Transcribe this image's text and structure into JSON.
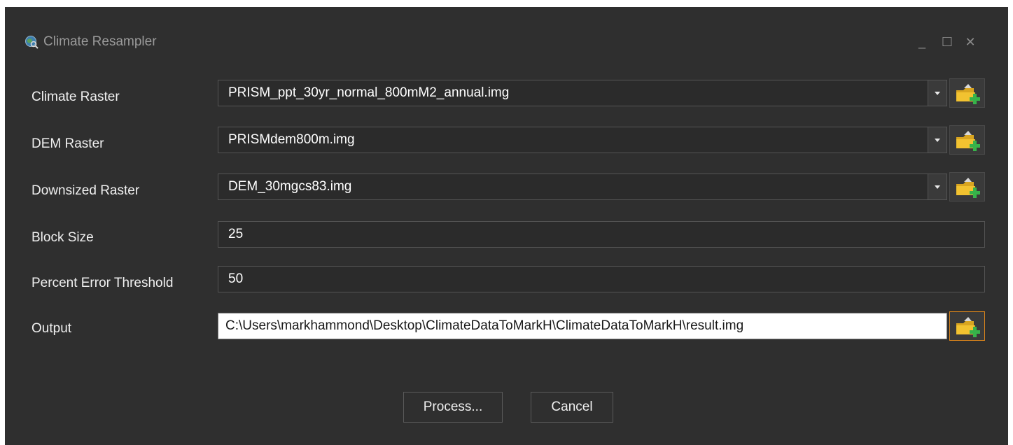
{
  "window": {
    "title": "Climate Resampler",
    "controls": {
      "minimize": "_",
      "maximize": "☐",
      "close": "✕"
    }
  },
  "form": {
    "climate_raster": {
      "label": "Climate Raster",
      "value": "PRISM_ppt_30yr_normal_800mM2_annual.img"
    },
    "dem_raster": {
      "label": "DEM Raster",
      "value": "PRISMdem800m.img"
    },
    "downsized_raster": {
      "label": "Downsized Raster",
      "value": "DEM_30mgcs83.img"
    },
    "block_size": {
      "label": "Block Size",
      "value": "25"
    },
    "percent_error": {
      "label": "Percent Error Threshold",
      "value": "50"
    },
    "output": {
      "label": "Output",
      "value": "C:\\Users\\markhammond\\Desktop\\ClimateDataToMarkH\\ClimateDataToMarkH\\result.img"
    }
  },
  "buttons": {
    "process": "Process...",
    "cancel": "Cancel"
  },
  "icons": {
    "app": "globe-magnifier-icon",
    "browse": "add-folder-icon",
    "dropdown": "dropdown-arrow-icon"
  },
  "colors": {
    "window_bg": "#2f2f2f",
    "accent_focus": "#e0871a",
    "folder_yellow": "#f2c230",
    "plus_green": "#37b34a"
  }
}
